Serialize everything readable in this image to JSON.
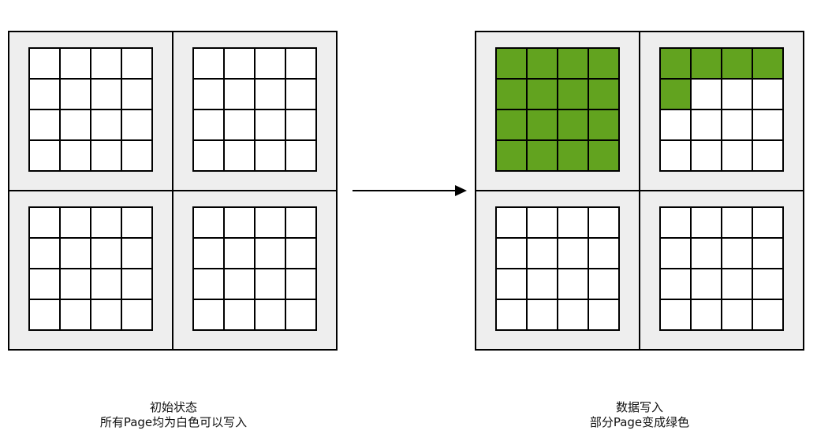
{
  "colors": {
    "background": "#ffffff",
    "block_fill": "#eeeeee",
    "stroke": "#000000",
    "written": "#62a31f",
    "free": "#ffffff"
  },
  "left_state": {
    "title": "初始状态",
    "subtitle": "所有Page均为白色可以写入",
    "blocks": [
      {
        "written_pages": 0
      },
      {
        "written_pages": 0
      },
      {
        "written_pages": 0
      },
      {
        "written_pages": 0
      }
    ]
  },
  "right_state": {
    "title": "数据写入",
    "subtitle": "部分Page变成绿色",
    "blocks": [
      {
        "written_pages": 16
      },
      {
        "written_pages": 5
      },
      {
        "written_pages": 0
      },
      {
        "written_pages": 0
      }
    ]
  },
  "pages_per_block": 16
}
